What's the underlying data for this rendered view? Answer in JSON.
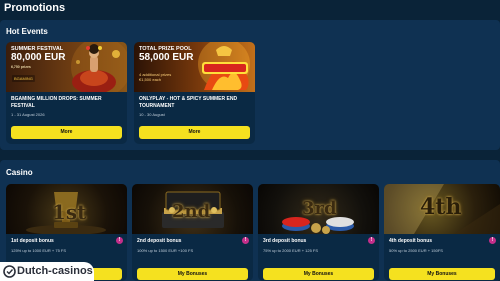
{
  "page": {
    "title": "Promotions"
  },
  "hot_events": {
    "title": "Hot Events",
    "cards": [
      {
        "banner_line1": "SUMMER FESTIVAL",
        "banner_amount": "80,000 EUR",
        "banner_sub": "6,750 prizes",
        "banner_logo": "BGAMING",
        "title": "BGAMING MILLION DROPS: SUMMER FESTIVAL",
        "date": "1 - 31 August 2026",
        "button": "More"
      },
      {
        "banner_line1": "TOTAL PRIZE POOL",
        "banner_amount": "58,000 EUR",
        "banner_sub1": "4 additional prizes",
        "banner_sub2": "€1,500 each",
        "title": "ONLYPLAY - HOT & SPICY SUMMER END TOURNAMENT",
        "date": "10 - 30 August",
        "button": "More"
      }
    ]
  },
  "casino": {
    "title": "Casino",
    "cards": [
      {
        "badge": "1st",
        "title": "1st deposit bonus",
        "desc": "125% up to 1000 EUR + 75 FS",
        "button": "My Bonuses"
      },
      {
        "badge": "2nd",
        "title": "2nd deposit bonus",
        "desc": "100% up to 1500 EUR +100 FS",
        "button": "My Bonuses"
      },
      {
        "badge": "3rd",
        "title": "3rd deposit bonus",
        "desc": "75% up to 2000 EUR + 125 FS",
        "button": "My Bonuses"
      },
      {
        "badge": "4th",
        "title": "4th deposit bonus",
        "desc": "50% up to 2500 EUR + 150FS",
        "button": "My Bonuses"
      }
    ]
  },
  "watermark": {
    "text": "Dutch-casinos"
  },
  "colors": {
    "background": "#0a2338",
    "panel": "#0f3152",
    "button": "#f5e11f",
    "info": "#c42e8a"
  },
  "icons": [
    "info-icon",
    "dutch-casinos-logo-icon"
  ]
}
